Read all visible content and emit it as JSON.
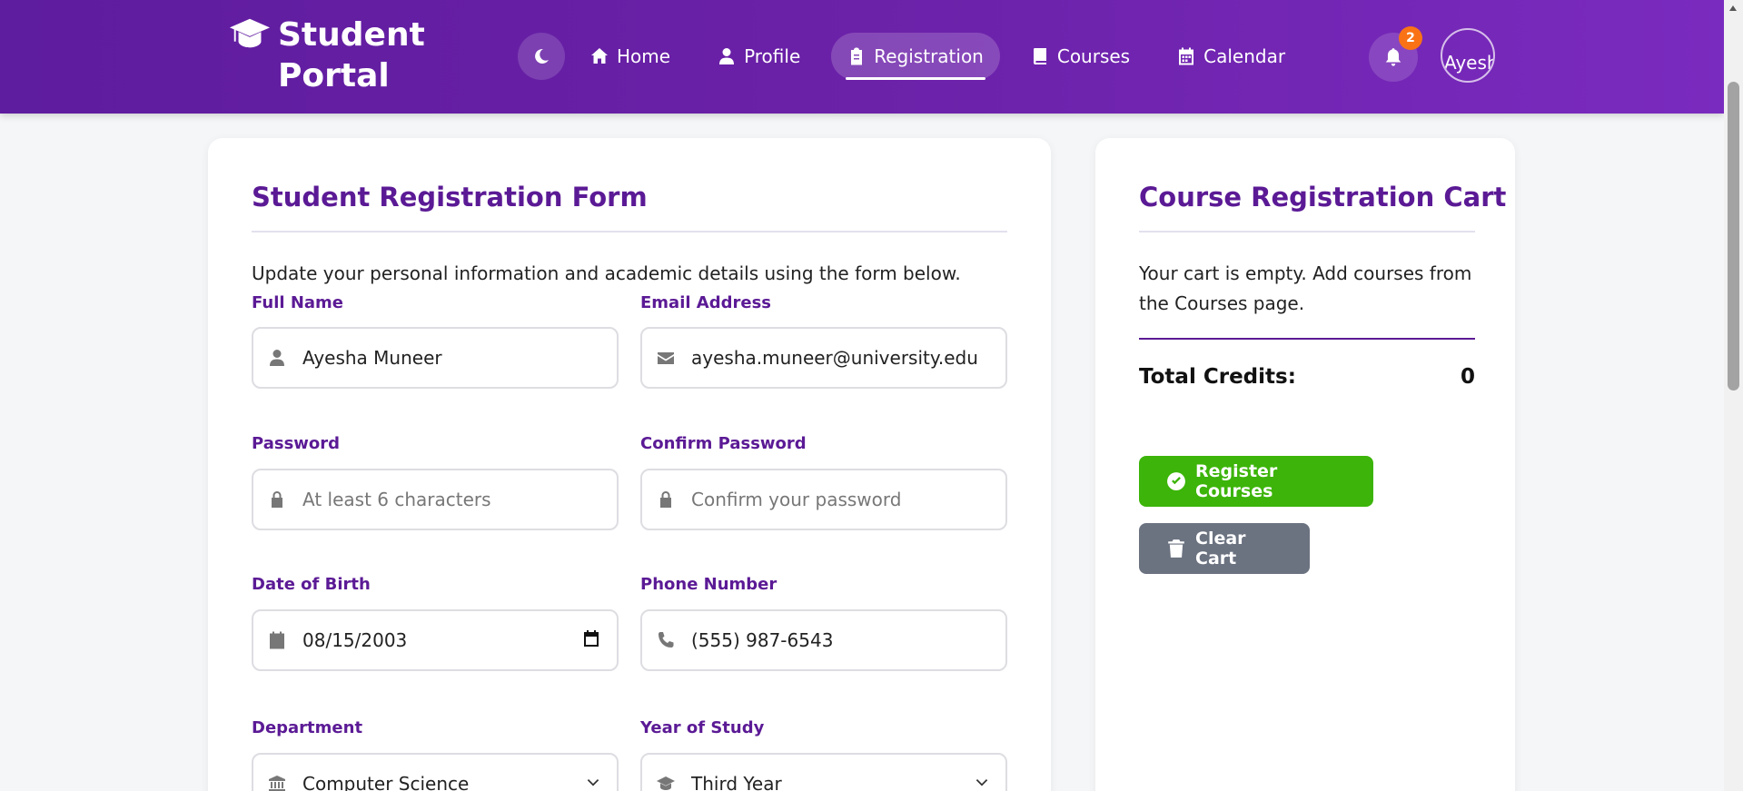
{
  "header": {
    "brand": "Student Portal",
    "nav": [
      {
        "label": "Home",
        "icon": "home-icon"
      },
      {
        "label": "Profile",
        "icon": "user-icon"
      },
      {
        "label": "Registration",
        "icon": "clipboard-icon",
        "active": true
      },
      {
        "label": "Courses",
        "icon": "book-icon"
      },
      {
        "label": "Calendar",
        "icon": "calendar-icon"
      }
    ],
    "notification_count": "2",
    "avatar_alt": "Ayesh"
  },
  "form": {
    "title": "Student Registration Form",
    "intro": "Update your personal information and academic details using the form below.",
    "full_name": {
      "label": "Full Name",
      "value": "Ayesha Muneer"
    },
    "email": {
      "label": "Email Address",
      "value": "ayesha.muneer@university.edu"
    },
    "password": {
      "label": "Password",
      "placeholder": "At least 6 characters"
    },
    "confirm_password": {
      "label": "Confirm Password",
      "placeholder": "Confirm your password"
    },
    "dob": {
      "label": "Date of Birth",
      "value": "08/15/2003"
    },
    "phone": {
      "label": "Phone Number",
      "value": "(555) 987-6543"
    },
    "department": {
      "label": "Department",
      "value": "Computer Science"
    },
    "year": {
      "label": "Year of Study",
      "value": "Third Year"
    }
  },
  "cart": {
    "title": "Course Registration Cart",
    "empty_text": "Your cart is empty. Add courses from the Courses page.",
    "total_label": "Total Credits:",
    "total_value": "0",
    "register_label": "Register Courses",
    "clear_label": "Clear Cart"
  },
  "colors": {
    "header": "#6b21a8",
    "accent": "#5b1a95",
    "register": "#3cb409",
    "clear": "#6b7280",
    "badge": "#f97316"
  }
}
